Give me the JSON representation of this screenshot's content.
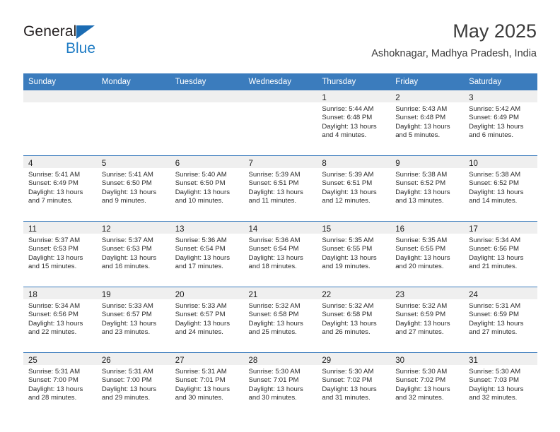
{
  "logo": {
    "word_top": "General",
    "word_bottom": "Blue",
    "triangle_icon": "blue-triangle-icon",
    "accent_dark": "#231f20",
    "accent_blue": "#1f7cc4"
  },
  "header": {
    "month_title": "May 2025",
    "location": "Ashoknagar, Madhya Pradesh, India"
  },
  "theme": {
    "header_blue": "#3b7cbd",
    "daynum_strip": "#efefef",
    "cell_background": "#ffffff",
    "text": "#2b2b2b"
  },
  "weekday_headers": [
    "Sunday",
    "Monday",
    "Tuesday",
    "Wednesday",
    "Thursday",
    "Friday",
    "Saturday"
  ],
  "weeks": [
    [
      {
        "day": "",
        "sunrise": "",
        "sunset": "",
        "daylight_line1": "",
        "daylight_line2": "",
        "empty": true
      },
      {
        "day": "",
        "sunrise": "",
        "sunset": "",
        "daylight_line1": "",
        "daylight_line2": "",
        "empty": true
      },
      {
        "day": "",
        "sunrise": "",
        "sunset": "",
        "daylight_line1": "",
        "daylight_line2": "",
        "empty": true
      },
      {
        "day": "",
        "sunrise": "",
        "sunset": "",
        "daylight_line1": "",
        "daylight_line2": "",
        "empty": true
      },
      {
        "day": "1",
        "sunrise": "Sunrise: 5:44 AM",
        "sunset": "Sunset: 6:48 PM",
        "daylight_line1": "Daylight: 13 hours",
        "daylight_line2": "and 4 minutes."
      },
      {
        "day": "2",
        "sunrise": "Sunrise: 5:43 AM",
        "sunset": "Sunset: 6:48 PM",
        "daylight_line1": "Daylight: 13 hours",
        "daylight_line2": "and 5 minutes."
      },
      {
        "day": "3",
        "sunrise": "Sunrise: 5:42 AM",
        "sunset": "Sunset: 6:49 PM",
        "daylight_line1": "Daylight: 13 hours",
        "daylight_line2": "and 6 minutes."
      }
    ],
    [
      {
        "day": "4",
        "sunrise": "Sunrise: 5:41 AM",
        "sunset": "Sunset: 6:49 PM",
        "daylight_line1": "Daylight: 13 hours",
        "daylight_line2": "and 7 minutes."
      },
      {
        "day": "5",
        "sunrise": "Sunrise: 5:41 AM",
        "sunset": "Sunset: 6:50 PM",
        "daylight_line1": "Daylight: 13 hours",
        "daylight_line2": "and 9 minutes."
      },
      {
        "day": "6",
        "sunrise": "Sunrise: 5:40 AM",
        "sunset": "Sunset: 6:50 PM",
        "daylight_line1": "Daylight: 13 hours",
        "daylight_line2": "and 10 minutes."
      },
      {
        "day": "7",
        "sunrise": "Sunrise: 5:39 AM",
        "sunset": "Sunset: 6:51 PM",
        "daylight_line1": "Daylight: 13 hours",
        "daylight_line2": "and 11 minutes."
      },
      {
        "day": "8",
        "sunrise": "Sunrise: 5:39 AM",
        "sunset": "Sunset: 6:51 PM",
        "daylight_line1": "Daylight: 13 hours",
        "daylight_line2": "and 12 minutes."
      },
      {
        "day": "9",
        "sunrise": "Sunrise: 5:38 AM",
        "sunset": "Sunset: 6:52 PM",
        "daylight_line1": "Daylight: 13 hours",
        "daylight_line2": "and 13 minutes."
      },
      {
        "day": "10",
        "sunrise": "Sunrise: 5:38 AM",
        "sunset": "Sunset: 6:52 PM",
        "daylight_line1": "Daylight: 13 hours",
        "daylight_line2": "and 14 minutes."
      }
    ],
    [
      {
        "day": "11",
        "sunrise": "Sunrise: 5:37 AM",
        "sunset": "Sunset: 6:53 PM",
        "daylight_line1": "Daylight: 13 hours",
        "daylight_line2": "and 15 minutes."
      },
      {
        "day": "12",
        "sunrise": "Sunrise: 5:37 AM",
        "sunset": "Sunset: 6:53 PM",
        "daylight_line1": "Daylight: 13 hours",
        "daylight_line2": "and 16 minutes."
      },
      {
        "day": "13",
        "sunrise": "Sunrise: 5:36 AM",
        "sunset": "Sunset: 6:54 PM",
        "daylight_line1": "Daylight: 13 hours",
        "daylight_line2": "and 17 minutes."
      },
      {
        "day": "14",
        "sunrise": "Sunrise: 5:36 AM",
        "sunset": "Sunset: 6:54 PM",
        "daylight_line1": "Daylight: 13 hours",
        "daylight_line2": "and 18 minutes."
      },
      {
        "day": "15",
        "sunrise": "Sunrise: 5:35 AM",
        "sunset": "Sunset: 6:55 PM",
        "daylight_line1": "Daylight: 13 hours",
        "daylight_line2": "and 19 minutes."
      },
      {
        "day": "16",
        "sunrise": "Sunrise: 5:35 AM",
        "sunset": "Sunset: 6:55 PM",
        "daylight_line1": "Daylight: 13 hours",
        "daylight_line2": "and 20 minutes."
      },
      {
        "day": "17",
        "sunrise": "Sunrise: 5:34 AM",
        "sunset": "Sunset: 6:56 PM",
        "daylight_line1": "Daylight: 13 hours",
        "daylight_line2": "and 21 minutes."
      }
    ],
    [
      {
        "day": "18",
        "sunrise": "Sunrise: 5:34 AM",
        "sunset": "Sunset: 6:56 PM",
        "daylight_line1": "Daylight: 13 hours",
        "daylight_line2": "and 22 minutes."
      },
      {
        "day": "19",
        "sunrise": "Sunrise: 5:33 AM",
        "sunset": "Sunset: 6:57 PM",
        "daylight_line1": "Daylight: 13 hours",
        "daylight_line2": "and 23 minutes."
      },
      {
        "day": "20",
        "sunrise": "Sunrise: 5:33 AM",
        "sunset": "Sunset: 6:57 PM",
        "daylight_line1": "Daylight: 13 hours",
        "daylight_line2": "and 24 minutes."
      },
      {
        "day": "21",
        "sunrise": "Sunrise: 5:32 AM",
        "sunset": "Sunset: 6:58 PM",
        "daylight_line1": "Daylight: 13 hours",
        "daylight_line2": "and 25 minutes."
      },
      {
        "day": "22",
        "sunrise": "Sunrise: 5:32 AM",
        "sunset": "Sunset: 6:58 PM",
        "daylight_line1": "Daylight: 13 hours",
        "daylight_line2": "and 26 minutes."
      },
      {
        "day": "23",
        "sunrise": "Sunrise: 5:32 AM",
        "sunset": "Sunset: 6:59 PM",
        "daylight_line1": "Daylight: 13 hours",
        "daylight_line2": "and 27 minutes."
      },
      {
        "day": "24",
        "sunrise": "Sunrise: 5:31 AM",
        "sunset": "Sunset: 6:59 PM",
        "daylight_line1": "Daylight: 13 hours",
        "daylight_line2": "and 27 minutes."
      }
    ],
    [
      {
        "day": "25",
        "sunrise": "Sunrise: 5:31 AM",
        "sunset": "Sunset: 7:00 PM",
        "daylight_line1": "Daylight: 13 hours",
        "daylight_line2": "and 28 minutes."
      },
      {
        "day": "26",
        "sunrise": "Sunrise: 5:31 AM",
        "sunset": "Sunset: 7:00 PM",
        "daylight_line1": "Daylight: 13 hours",
        "daylight_line2": "and 29 minutes."
      },
      {
        "day": "27",
        "sunrise": "Sunrise: 5:31 AM",
        "sunset": "Sunset: 7:01 PM",
        "daylight_line1": "Daylight: 13 hours",
        "daylight_line2": "and 30 minutes."
      },
      {
        "day": "28",
        "sunrise": "Sunrise: 5:30 AM",
        "sunset": "Sunset: 7:01 PM",
        "daylight_line1": "Daylight: 13 hours",
        "daylight_line2": "and 30 minutes."
      },
      {
        "day": "29",
        "sunrise": "Sunrise: 5:30 AM",
        "sunset": "Sunset: 7:02 PM",
        "daylight_line1": "Daylight: 13 hours",
        "daylight_line2": "and 31 minutes."
      },
      {
        "day": "30",
        "sunrise": "Sunrise: 5:30 AM",
        "sunset": "Sunset: 7:02 PM",
        "daylight_line1": "Daylight: 13 hours",
        "daylight_line2": "and 32 minutes."
      },
      {
        "day": "31",
        "sunrise": "Sunrise: 5:30 AM",
        "sunset": "Sunset: 7:03 PM",
        "daylight_line1": "Daylight: 13 hours",
        "daylight_line2": "and 32 minutes."
      }
    ]
  ]
}
